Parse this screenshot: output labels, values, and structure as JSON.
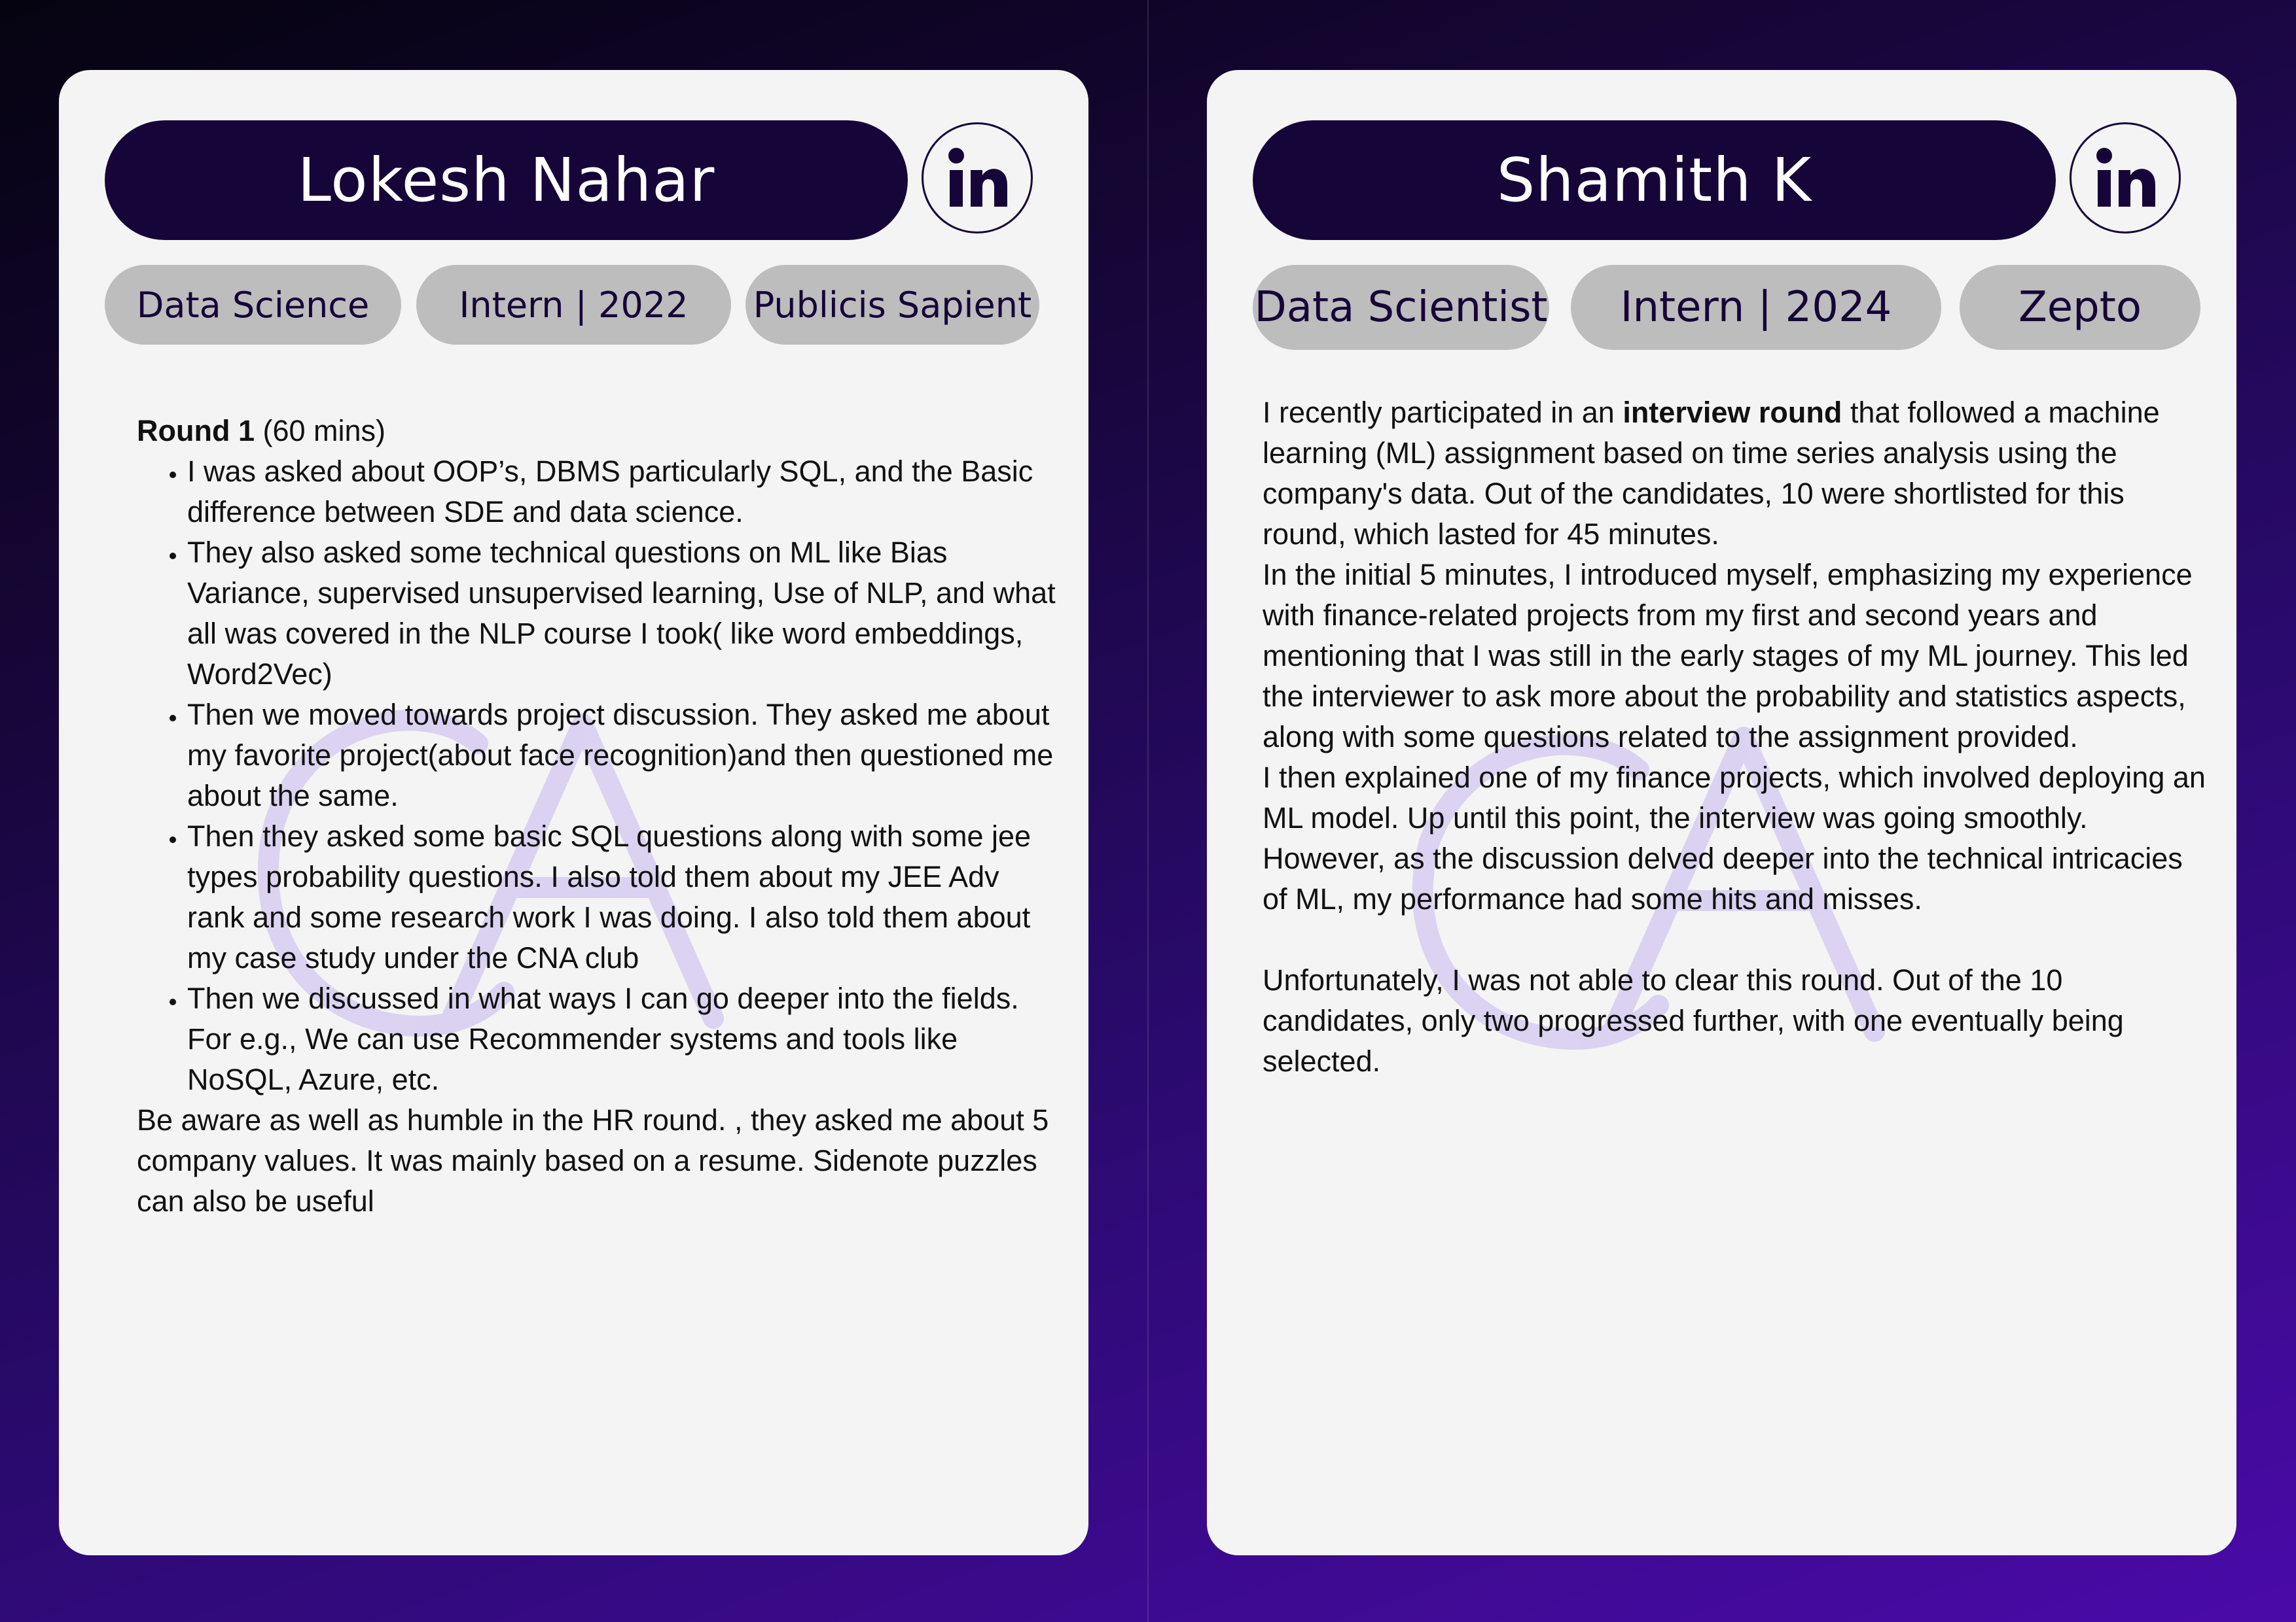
{
  "left_card": {
    "name": "Lokesh Nahar",
    "linkedin_icon": "linkedin-icon",
    "tags": [
      "Data Science",
      "Intern | 2022",
      "Publicis Sapient"
    ],
    "round_title": "Round 1",
    "round_duration": "(60 mins)",
    "bullets": [
      "I was asked about OOP’s, DBMS particularly SQL, and the Basic difference between SDE and data science.",
      "They also asked some technical questions on ML like Bias Variance, supervised unsupervised learning, Use of NLP, and what all was covered in the NLP course I took( like word embeddings, Word2Vec)",
      "Then we moved towards project discussion. They asked me about my favorite project(about face recognition)and then questioned me about the same.",
      "Then they asked some basic SQL questions along with some jee types probability questions. I also told them about my JEE Adv rank and some research work I was doing. I also told them about my case study under the CNA club",
      "Then we discussed in what ways I can go deeper into the fields. For e.g., We can use Recommender systems and tools like NoSQL, Azure, etc."
    ],
    "closing": "Be aware as well as humble in the HR round. , they asked me about 5 company values. It was mainly based on a resume. Sidenote puzzles can also be useful"
  },
  "right_card": {
    "name": "Shamith K",
    "linkedin_icon": "linkedin-icon",
    "tags": [
      "Data Scientist",
      "Intern | 2024",
      "Zepto"
    ],
    "para1_before": "I recently participated in an ",
    "para1_bold": "interview round",
    "para1_after": " that followed a machine learning (ML) assignment based on time series analysis using the company's data. Out of the candidates, 10 were shortlisted for this round, which lasted for 45 minutes.",
    "para2": "In the initial 5 minutes, I introduced myself, emphasizing my experience with finance-related projects from my first and second years and mentioning that I was still in the early stages of my ML journey. This led the interviewer to ask more about the probability and statistics aspects, along with some questions related to the assignment provided.",
    "para3": "I then explained one of my finance projects, which involved deploying an ML model. Up until this point, the interview was going smoothly. However, as the discussion delved deeper into the technical intricacies of ML, my performance had some hits and misses.",
    "para4": "Unfortunately, I was not able to clear this round. Out of the 10 candidates, only two progressed further, with one eventually being selected."
  },
  "colors": {
    "pill_dark": "#160538",
    "tag_gray": "#bdbdbd",
    "card_bg": "#f4f4f4",
    "watermark": "#d6cdf0"
  }
}
